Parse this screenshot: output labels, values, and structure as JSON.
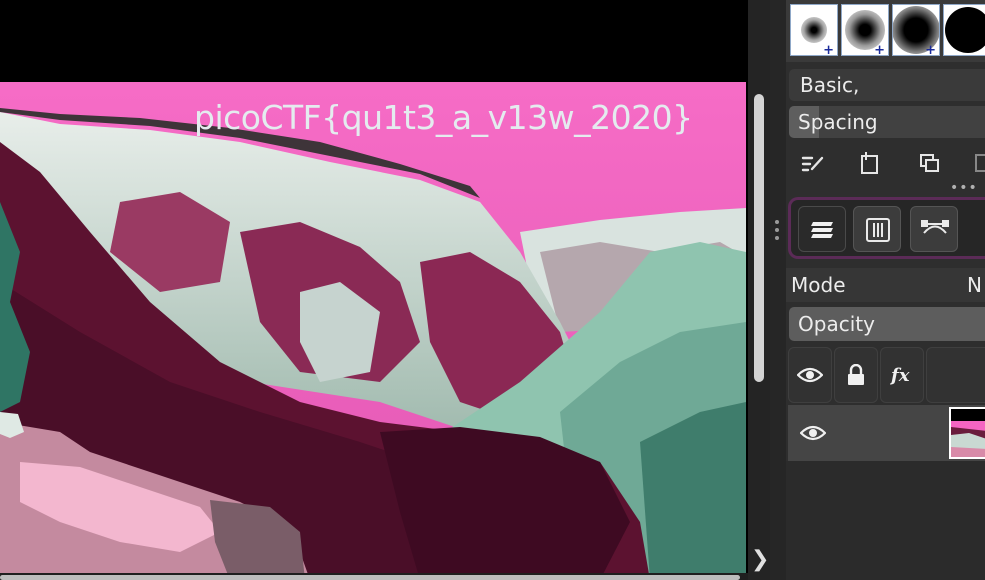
{
  "canvas": {
    "overlay_text": "picoCTF{qu1t3_a_v13w_2020}",
    "colors": {
      "sky": "#f565c2",
      "sky_bottom": "#e85bb4",
      "mountain_dark": "#5e1330",
      "rock_light": "#d8e6e0",
      "foliage": "#7fb9a4"
    }
  },
  "brush_presets": {
    "items": [
      {
        "name": "soft-small-brush",
        "has_add_marker": true
      },
      {
        "name": "soft-medium-brush",
        "has_add_marker": true
      },
      {
        "name": "soft-large-brush",
        "has_add_marker": true
      },
      {
        "name": "hard-round-brush",
        "has_add_marker": false
      }
    ],
    "add_marker": "+",
    "tag_filter": "Basic,",
    "spacing_label": "Spacing"
  },
  "preset_toolbar": {
    "icons": [
      "edit-brush-icon",
      "import-brush-icon",
      "duplicate-brush-icon",
      "overflow-icon"
    ],
    "more": "•••"
  },
  "docker_tabs": [
    {
      "icon": "layers-icon",
      "active": true
    },
    {
      "icon": "channels-icon",
      "active": false
    },
    {
      "icon": "paths-icon",
      "active": false
    }
  ],
  "layers": {
    "mode_label": "Mode",
    "mode_value": "N",
    "opacity_label": "Opacity",
    "header_icons": [
      "visibility-icon",
      "lock-icon",
      "fx-icon"
    ],
    "rows": [
      {
        "visible": true,
        "thumbnail": "layer-thumbnail"
      }
    ]
  },
  "scrollbars": {
    "expand_glyph": "❯"
  }
}
